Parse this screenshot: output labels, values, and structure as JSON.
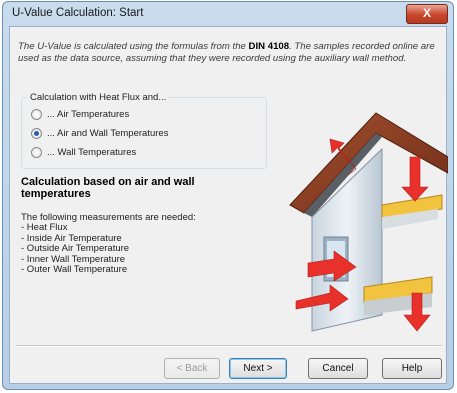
{
  "window": {
    "title": "U-Value Calculation: Start",
    "close_label": "X"
  },
  "intro": {
    "part1": "The U-Value is calculated using the formulas from the ",
    "standard": "DIN 4108",
    "part2": ". The samples recorded online are used as the data source, assuming that they were recorded using the auxiliary wall method."
  },
  "calc_group": {
    "label": "Calculation with Heat Flux and...",
    "options": [
      {
        "label": "... Air Temperatures",
        "checked": false
      },
      {
        "label": "... Air and Wall Temperatures",
        "checked": true
      },
      {
        "label": "... Wall Temperatures",
        "checked": false
      }
    ]
  },
  "description": {
    "title": "Calculation based on air and wall temperatures",
    "needed_heading": "The following measurements are needed:",
    "items": [
      "- Heat Flux",
      "- Inside Air Temperature",
      "- Outside Air Temperature",
      "- Inner Wall Temperature",
      "- Outer Wall Temperature"
    ]
  },
  "buttons": {
    "back": "< Back",
    "next": "Next >",
    "cancel": "Cancel",
    "help": "Help"
  },
  "colors": {
    "roof": "#8a3b22",
    "arrow": "#e8312a",
    "insulation": "#f2c33e",
    "wall": "#dfe7ee"
  }
}
